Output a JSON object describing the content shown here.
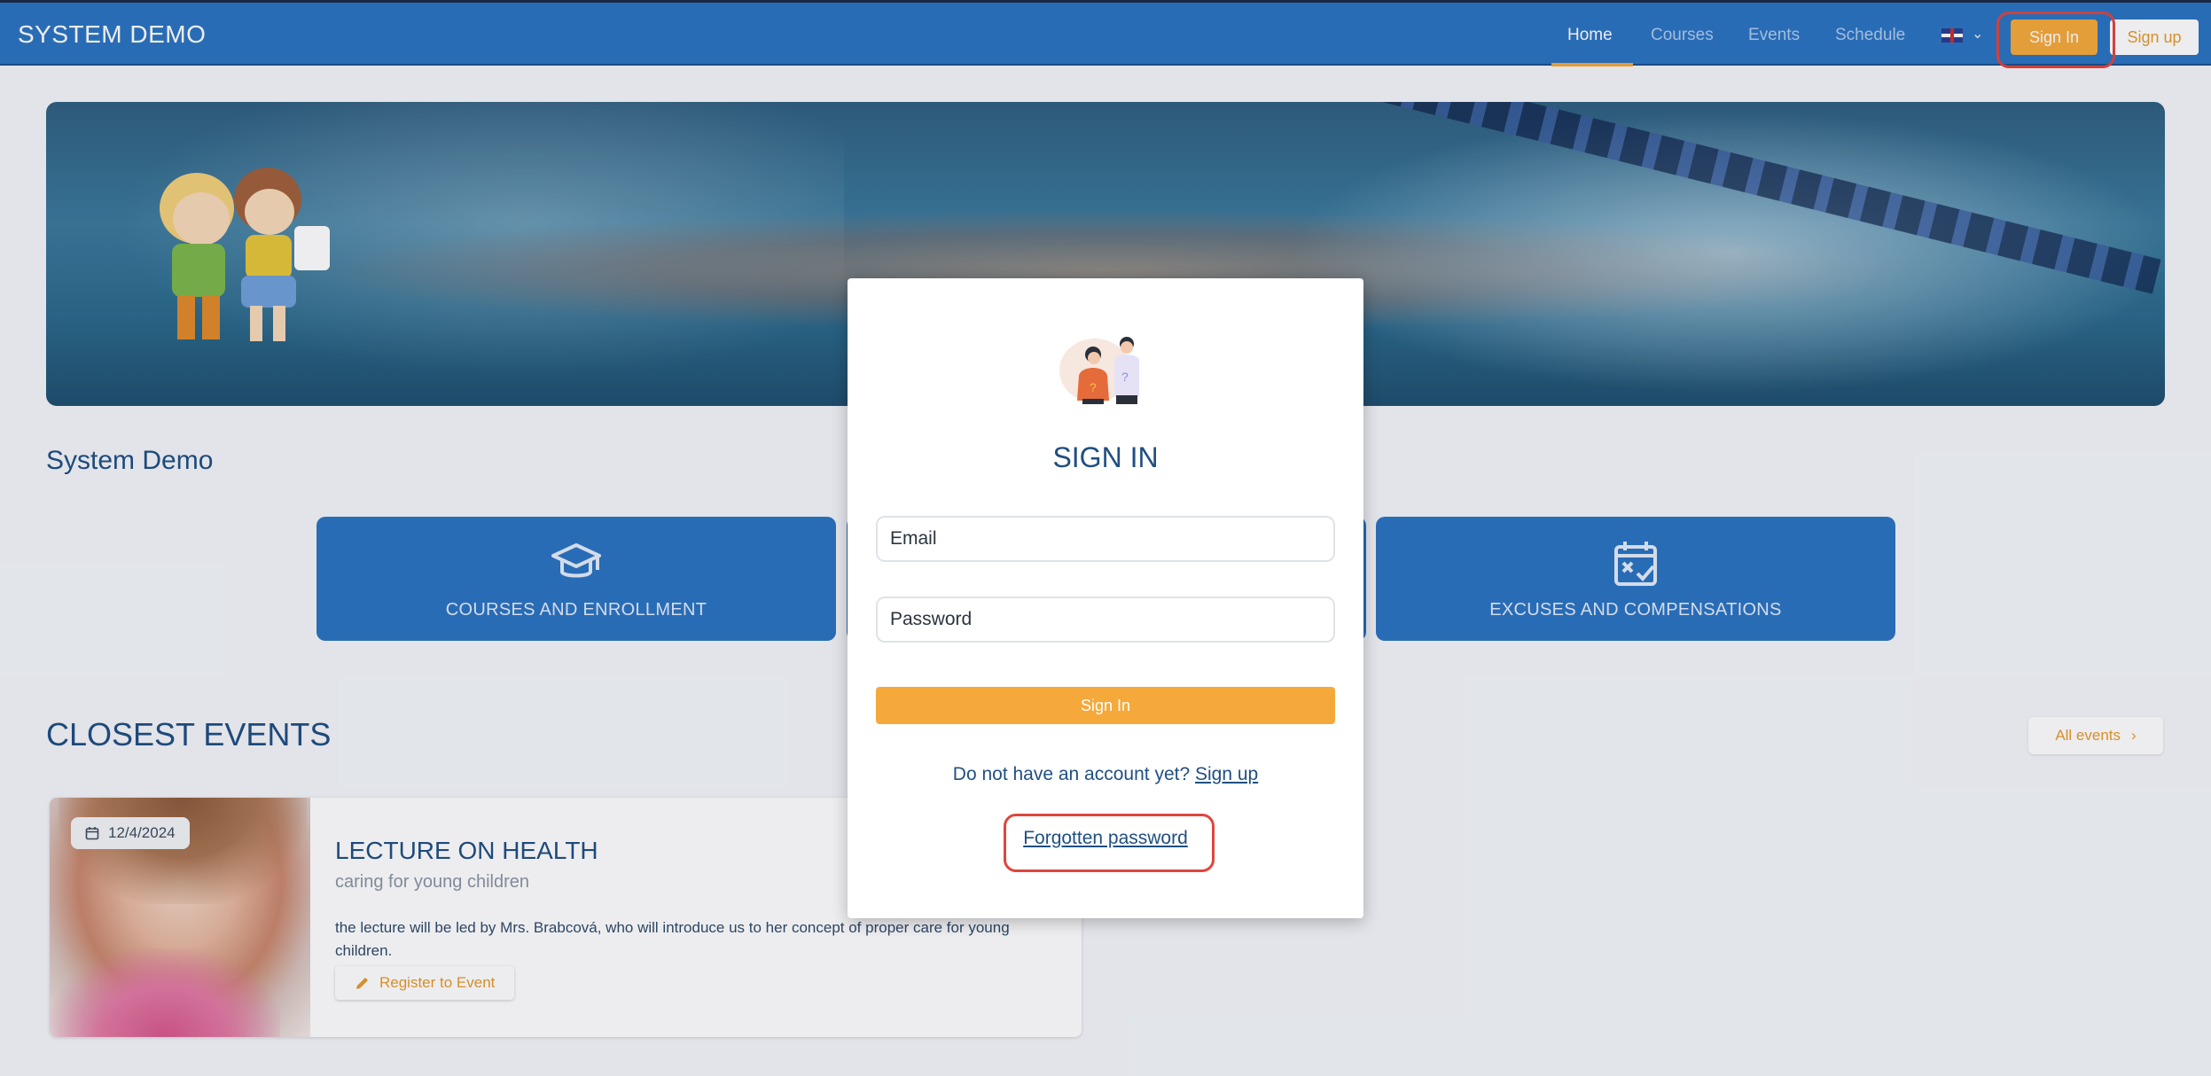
{
  "header": {
    "brand": "SYSTEM DEMO",
    "nav": [
      "Home",
      "Courses",
      "Events",
      "Schedule"
    ],
    "active_nav": "Home",
    "language_icon": "uk-flag-icon",
    "sign_in_label": "Sign In",
    "sign_up_label": "Sign up"
  },
  "page": {
    "title": "System Demo",
    "tiles": [
      {
        "label": "COURSES AND ENROLLMENT",
        "icon": "graduation-cap-icon"
      },
      {
        "label": "",
        "icon": ""
      },
      {
        "label": "EXCUSES AND COMPENSATIONS",
        "icon": "calendar-x-check-icon"
      }
    ],
    "events_title": "CLOSEST EVENTS",
    "all_events_label": "All events"
  },
  "event": {
    "date": "12/4/2024",
    "name": "LECTURE ON HEALTH",
    "subtitle": "caring for young children",
    "description": "the lecture will be led by Mrs. Brabcová, who will introduce us to her concept of proper care for young children.",
    "register_label": "Register to Event"
  },
  "modal": {
    "title": "SIGN IN",
    "email_placeholder": "Email",
    "password_placeholder": "Password",
    "submit_label": "Sign In",
    "no_account_text": "Do not have an account yet?",
    "sign_up_link": "Sign up",
    "forgot_link": "Forgotten password"
  },
  "colors": {
    "primary": "#2b73c2",
    "accent": "#f5a93a",
    "text_dark": "#1f4f82",
    "highlight": "#e0453d"
  }
}
